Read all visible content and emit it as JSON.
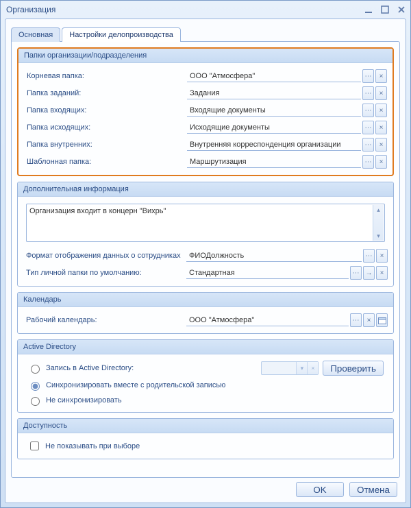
{
  "window": {
    "title": "Организация"
  },
  "tabs": {
    "main": "Основная",
    "workflow": "Настройки делопроизводства"
  },
  "groups": {
    "folders": {
      "title": "Папки организации/подразделения",
      "rows": {
        "root": {
          "label": "Корневая папка:",
          "value": "ООО \"Атмосфера\""
        },
        "tasks": {
          "label": "Папка заданий:",
          "value": "Задания"
        },
        "incoming": {
          "label": "Папка входящих:",
          "value": "Входящие документы"
        },
        "outgoing": {
          "label": "Папка исходящих:",
          "value": "Исходящие документы"
        },
        "internal": {
          "label": "Папка внутренних:",
          "value": "Внутренняя корреспонденция организации"
        },
        "template": {
          "label": "Шаблонная папка:",
          "value": "Маршрутизация"
        }
      }
    },
    "extra": {
      "title": "Дополнительная информация",
      "text": "Организация входит в концерн \"Вихрь\"",
      "displayFormat": {
        "label": "Формат отображения данных о сотрудниках",
        "value": "ФИОДолжность"
      },
      "personalFolderType": {
        "label": "Тип личной папки по умолчанию:",
        "value": "Стандартная"
      }
    },
    "calendar": {
      "title": "Календарь",
      "row": {
        "label": "Рабочий календарь:",
        "value": "ООО \"Атмосфера\""
      }
    },
    "ad": {
      "title": "Active Directory",
      "opt_record": "Запись в Active Directory:",
      "opt_sync_parent": "Синхронизировать вместе с родительской записью",
      "opt_no_sync": "Не синхронизировать",
      "check_btn": "Проверить"
    },
    "availability": {
      "title": "Доступность",
      "hide_on_select": "Не показывать при выборе"
    }
  },
  "buttons": {
    "ok": "OK",
    "cancel": "Отмена"
  },
  "glyph": {
    "ellipsis": "⋯",
    "clear": "×",
    "arrow": "→",
    "dd": "▾",
    "up": "▴",
    "dn": "▾"
  }
}
